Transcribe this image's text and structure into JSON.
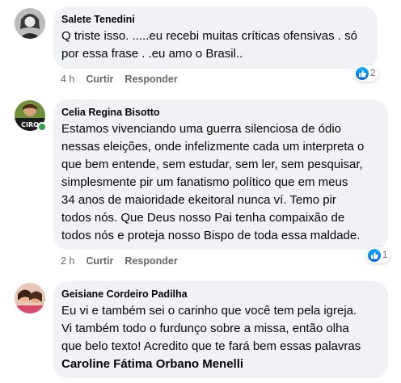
{
  "comments": [
    {
      "author": "Salete Tenedini",
      "text": "Q triste isso. .....eu recebi muitas críticas ofensivas . só\npor essa frase .  .eu amo o  Brasil..",
      "time": "4 h",
      "like_label": "Curtir",
      "reply_label": "Responder",
      "reaction_count": "2"
    },
    {
      "author": "Celia Regina Bisotto",
      "text": "Estamos vivenciando uma guerra silenciosa de ódio\nnessas eleições, onde infelizmente cada um interpreta o\nque bem entende, sem estudar, sem ler, sem pesquisar,\nsimplesmente pir um fanatismo político que em meus\n34 anos de maioridade ekeitoral nunca ví. Temo pir\ntodos nós. Que Deus nosso Pai tenha compaixão de\ntodos nós e proteja nosso Bispo de toda essa maldade.",
      "time": "2 h",
      "like_label": "Curtir",
      "reply_label": "Responder",
      "reaction_count": "1",
      "avatar_text": "CIRO"
    },
    {
      "author": "Geisiane Cordeiro Padilha",
      "text": "Eu vi e também sei o carinho que você tem pela igreja.\nVi também todo o furdunço sobre a missa, então olha\nque belo texto! Acredito que te fará bem essas palavras",
      "mention": "Caroline Fátima Orbano Menelli"
    }
  ],
  "colors": {
    "bubble": "#f0f2f5",
    "meta_text": "#65676b",
    "like_blue": "#0866ff",
    "online": "#31a24c"
  },
  "icons": {
    "reaction": "like-thumb-icon"
  }
}
